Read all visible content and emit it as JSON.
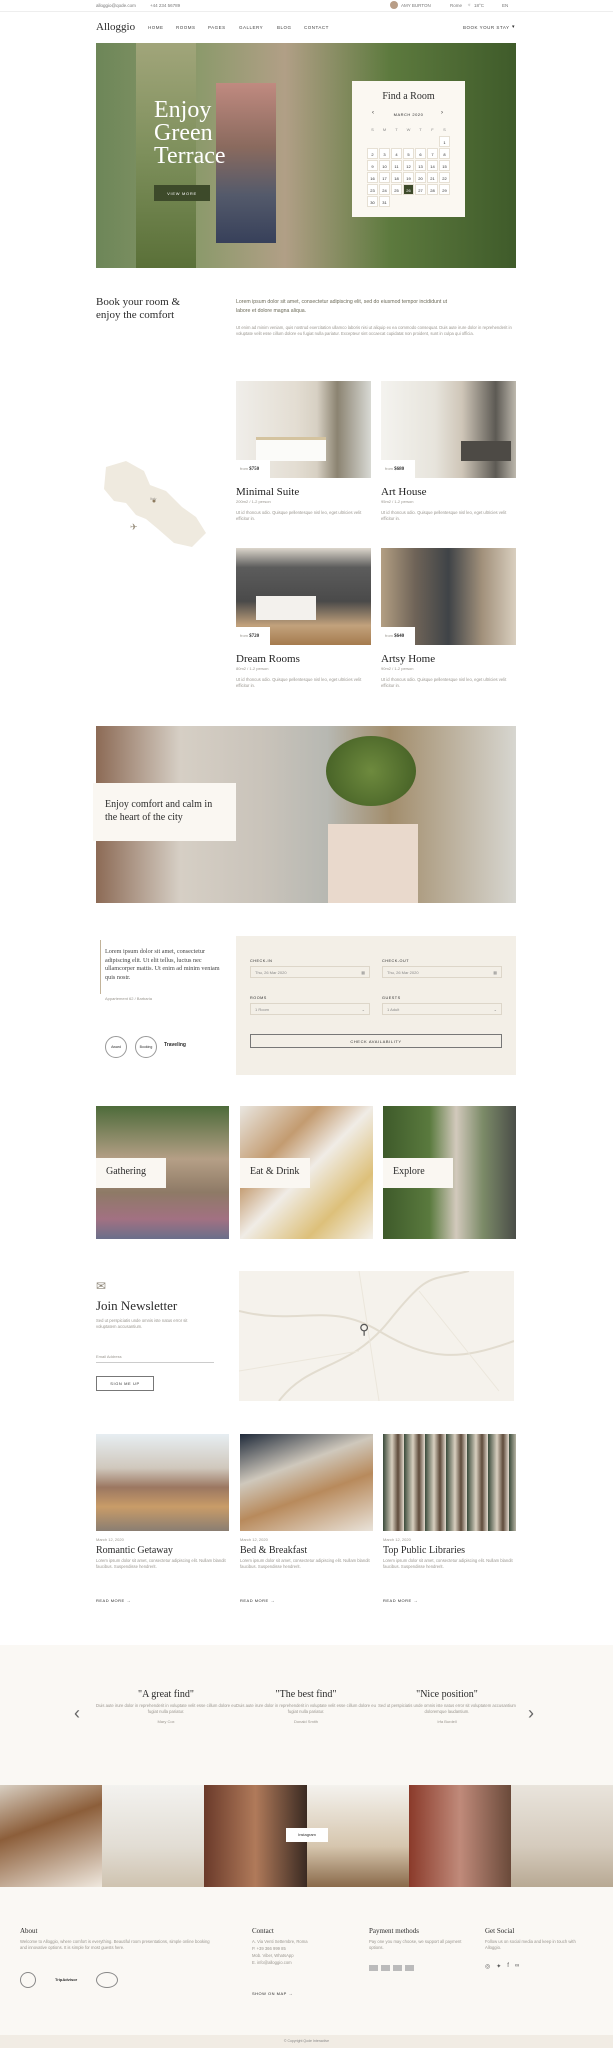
{
  "topbar": {
    "email": "alloggio@qode.com",
    "phone": "+44 234 56789",
    "user": "AMY BURTON",
    "city": "Rome",
    "temp": "18°C",
    "lang": "EN"
  },
  "nav": {
    "logo": "Alloggio",
    "items": [
      "HOME",
      "ROOMS",
      "PAGES",
      "GALLERY",
      "BLOG",
      "CONTACT"
    ],
    "cta": "BOOK YOUR STAY"
  },
  "hero": {
    "title_lines": [
      "Enjoy",
      "Green",
      "Terrace"
    ],
    "button": "VIEW MORE",
    "calendar": {
      "title": "Find a Room",
      "month": "MARCH 2020",
      "weekdays": [
        "S",
        "M",
        "T",
        "W",
        "T",
        "F",
        "S"
      ],
      "days": [
        "",
        "",
        "",
        "",
        "",
        "",
        "1",
        "2",
        "3",
        "4",
        "5",
        "6",
        "7",
        "8",
        "9",
        "10",
        "11",
        "12",
        "13",
        "14",
        "15",
        "16",
        "17",
        "18",
        "19",
        "20",
        "21",
        "22",
        "23",
        "24",
        "25",
        "26",
        "27",
        "28",
        "29",
        "30",
        "31"
      ]
    }
  },
  "intro": {
    "heading": "Book your room & enjoy the comfort",
    "lead": "Lorem ipsum dolor sit amet, consectetur adipiscing elit, sed do eiusmod tempor incididunt ut labore et dolore magna aliqua.",
    "body": "Ut enim ad minim veniam, quis nostrud exercitation ullamco laboris nisi ut aliquip ex ea commodo consequat. Duis aute irure dolor in reprehenderit in voluptate velit esse cillum dolore eu fugiat nulla pariatur. Excepteur sint occaecat cupidatat non proident, sunt in culpa qui officia."
  },
  "map_mini": {
    "label": "Italy"
  },
  "rooms": [
    {
      "price_prefix": "from",
      "price": "$750",
      "name": "Minimal Suite",
      "meta": "200m2 / 1-2 person",
      "desc": "Ut id rhoncus odio. Quisque pellentesque nisl leo, eget ultricies velit efficitur in."
    },
    {
      "price_prefix": "from",
      "price": "$680",
      "name": "Art House",
      "meta": "95m2 / 1-2 person",
      "desc": "Ut id rhoncus odio. Quisque pellentesque nisl leo, eget ultricies velit efficitur in."
    },
    {
      "price_prefix": "from",
      "price": "$720",
      "name": "Dream Rooms",
      "meta": "80m2 / 1-2 person",
      "desc": "Ut id rhoncus odio. Quisque pellentesque nisl leo, eget ultricies velit efficitur in."
    },
    {
      "price_prefix": "from",
      "price": "$640",
      "name": "Artsy Home",
      "meta": "90m2 / 1-2 person",
      "desc": "Ut id rhoncus odio. Quisque pellentesque nisl leo, eget ultricies velit efficitur in."
    }
  ],
  "banner": {
    "text": "Enjoy comfort and calm in the heart of the city"
  },
  "quote": {
    "text": "Lorem ipsum dolor sit amet, consectetur adipiscing elit. Ut elit tellus, luctus nec ullamcorper mattis. Ut enim ad minim veniam quis nostr.",
    "author": "Appartement 62 / Barbaria"
  },
  "badges": [
    "Award",
    "Booking",
    "Traveling"
  ],
  "booking": {
    "checkin_label": "CHECK-IN",
    "checkin": "Thu, 26 Mar 2020",
    "checkout_label": "CHECK-OUT",
    "checkout": "Thu, 26 Mar 2020",
    "rooms_label": "ROOMS",
    "rooms": "1 Room",
    "guests_label": "GUESTS",
    "guests": "1 Adult",
    "button": "CHECK AVAILABILITY"
  },
  "features": [
    {
      "label": "Gathering"
    },
    {
      "label": "Eat & Drink"
    },
    {
      "label": "Explore"
    }
  ],
  "newsletter": {
    "title": "Join Newsletter",
    "desc": "Sed ut perspiciatis unde omnis iste natus error sit voluptatem accusantium.",
    "placeholder": "Email Address",
    "button": "SIGN ME UP"
  },
  "blog": [
    {
      "date": "March 12, 2020",
      "title": "Romantic Getaway",
      "text": "Lorem ipsum dolor sit amet, consectetur adipiscing elit. Nullam blandit faucibus. Suspendisse hendrerit.",
      "link": "READ MORE"
    },
    {
      "date": "March 12, 2020",
      "title": "Bed & Breakfast",
      "text": "Lorem ipsum dolor sit amet, consectetur adipiscing elit. Nullam blandit faucibus. Suspendisse hendrerit.",
      "link": "READ MORE"
    },
    {
      "date": "March 12, 2020",
      "title": "Top Public Libraries",
      "text": "Lorem ipsum dolor sit amet, consectetur adipiscing elit. Nullam blandit faucibus. Suspendisse hendrerit.",
      "link": "READ MORE"
    }
  ],
  "testimonials": [
    {
      "title": "\"A great find\"",
      "text": "Duis aute irure dolor in reprehenderit in voluptate velit esse cillum dolore eu fugiat nulla pariatur.",
      "author": "Mary Cox"
    },
    {
      "title": "\"The best find\"",
      "text": "Duis aute irure dolor in reprehenderit in voluptate velit esse cillum dolore eu fugiat nulla pariatur.",
      "author": "Donald Smith"
    },
    {
      "title": "\"Nice position\"",
      "text": "Sed ut perspiciatis unde omnis iste natus error sit voluptatem accusantium doloremque laudantium.",
      "author": "Irfa Burdell"
    }
  ],
  "instagram": {
    "label": "Instagram"
  },
  "footer": {
    "about_title": "About",
    "about_text": "Welcome to Alloggio, where comfort is everything. Beautiful room presentations, simple online booking and innovative options. It is simple for most guests here.",
    "contact_title": "Contact",
    "contact_lines": [
      "A. Via Venti Settembre, Roma",
      "P. +39 366 999 85",
      "Mob. Viber, WhatsApp",
      "E. info@alloggio.com"
    ],
    "map_link": "SHOW ON MAP",
    "pay_title": "Payment methods",
    "pay_text": "Pay one you may choose, we support all payment options.",
    "social_title": "Get Social",
    "social_text": "Follow us on social media and keep in touch with Alloggio."
  },
  "copyright": "© Copyright Qode Interactive"
}
